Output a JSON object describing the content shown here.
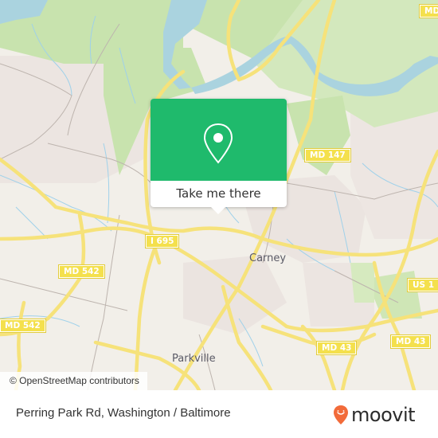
{
  "map": {
    "colors": {
      "land": "#f2efe9",
      "urban": "#e8e0dc",
      "forest": "#c8e3ae",
      "forest_light": "#d9ebc4",
      "water": "#aad3df",
      "stream": "#9fd1ea",
      "road_major": "#f6e27a",
      "road_minor": "#b8b0ac"
    },
    "shields": [
      {
        "id": "i695-west",
        "label": "I 695"
      },
      {
        "id": "i695-east",
        "label": "I 695"
      },
      {
        "id": "md542-a",
        "label": "MD 542"
      },
      {
        "id": "md542-b",
        "label": "MD 542"
      },
      {
        "id": "md147",
        "label": "MD 147"
      },
      {
        "id": "us1",
        "label": "US 1"
      },
      {
        "id": "md43-west",
        "label": "MD 43"
      },
      {
        "id": "md43-east",
        "label": "MD 43"
      },
      {
        "id": "md-top",
        "label": "MD"
      }
    ],
    "places": [
      {
        "id": "carney",
        "label": "Carney"
      },
      {
        "id": "parkville",
        "label": "Parkville"
      }
    ],
    "attribution": "© OpenStreetMap contributors"
  },
  "popup": {
    "icon": "map-pin-icon",
    "button_label": "Take me there",
    "accent": "#1fba6c"
  },
  "footer": {
    "location": "Perring Park Rd, Washington / Baltimore",
    "brand": "moovit",
    "brand_color": "#f26b3a"
  }
}
